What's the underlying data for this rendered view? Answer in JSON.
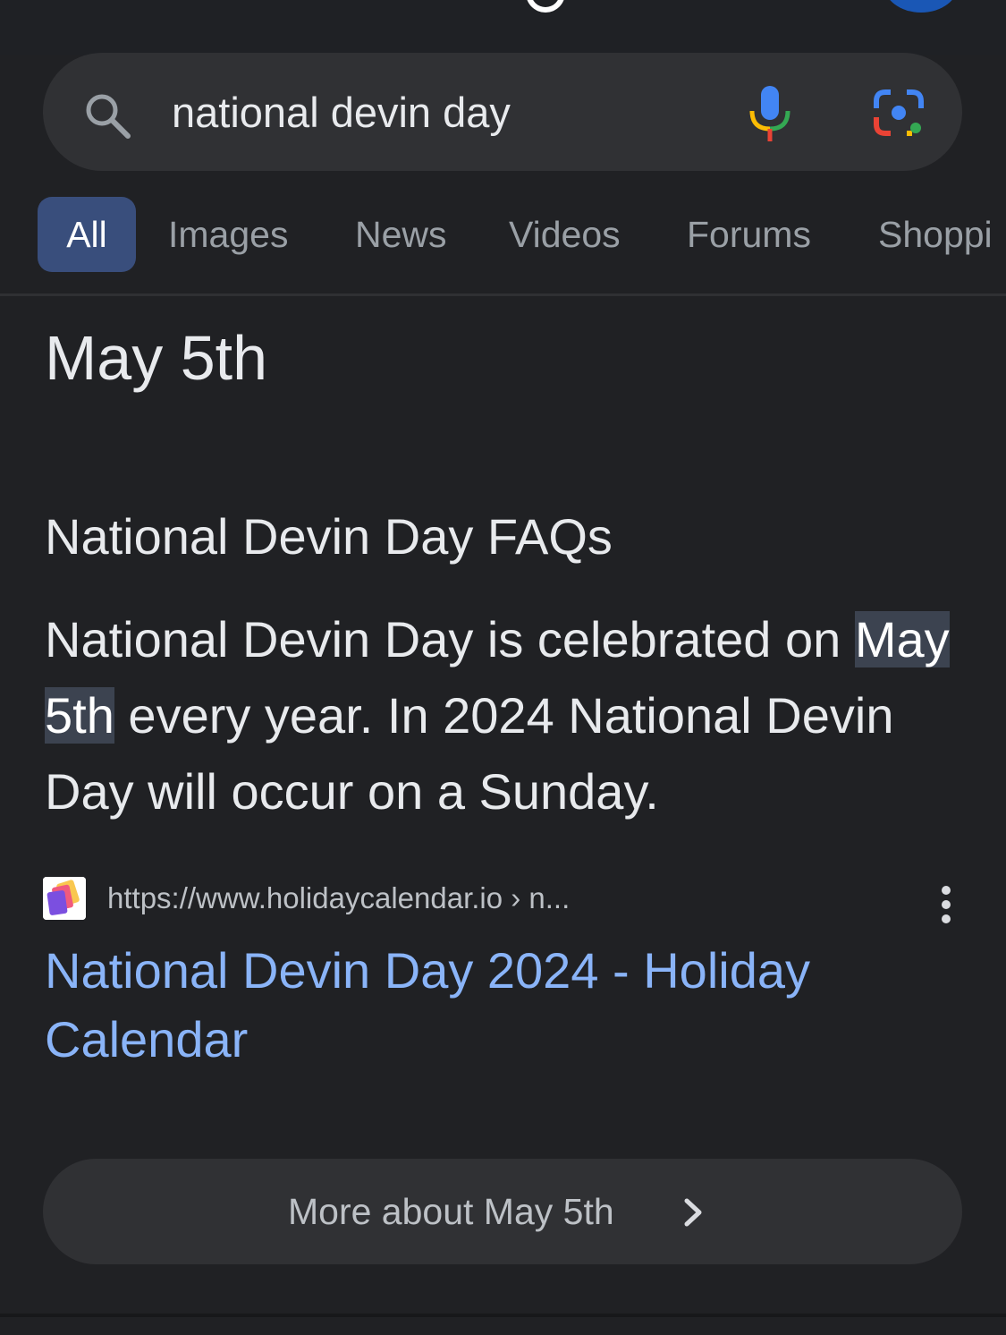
{
  "search": {
    "query": "national devin day"
  },
  "tabs": [
    {
      "label": "All",
      "active": true
    },
    {
      "label": "Images"
    },
    {
      "label": "News"
    },
    {
      "label": "Videos"
    },
    {
      "label": "Forums"
    },
    {
      "label": "Shoppi"
    }
  ],
  "answer": {
    "title": "May 5th"
  },
  "faq": {
    "heading": "National Devin Day FAQs",
    "text_before": "National Devin Day is celebrated on ",
    "highlight": "May 5th",
    "text_after": " every year. In 2024 National Devin Day will occur on a Sunday."
  },
  "result": {
    "url": "https://www.holidaycalendar.io › n...",
    "title": "National Devin Day 2024 - Holiday Calendar"
  },
  "more_button": {
    "label": "More about May 5th"
  },
  "colors": {
    "background": "#202124",
    "searchbar": "#303134",
    "active_tab": "#394e7c",
    "link": "#8ab4f8",
    "highlight": "#3c4350"
  }
}
